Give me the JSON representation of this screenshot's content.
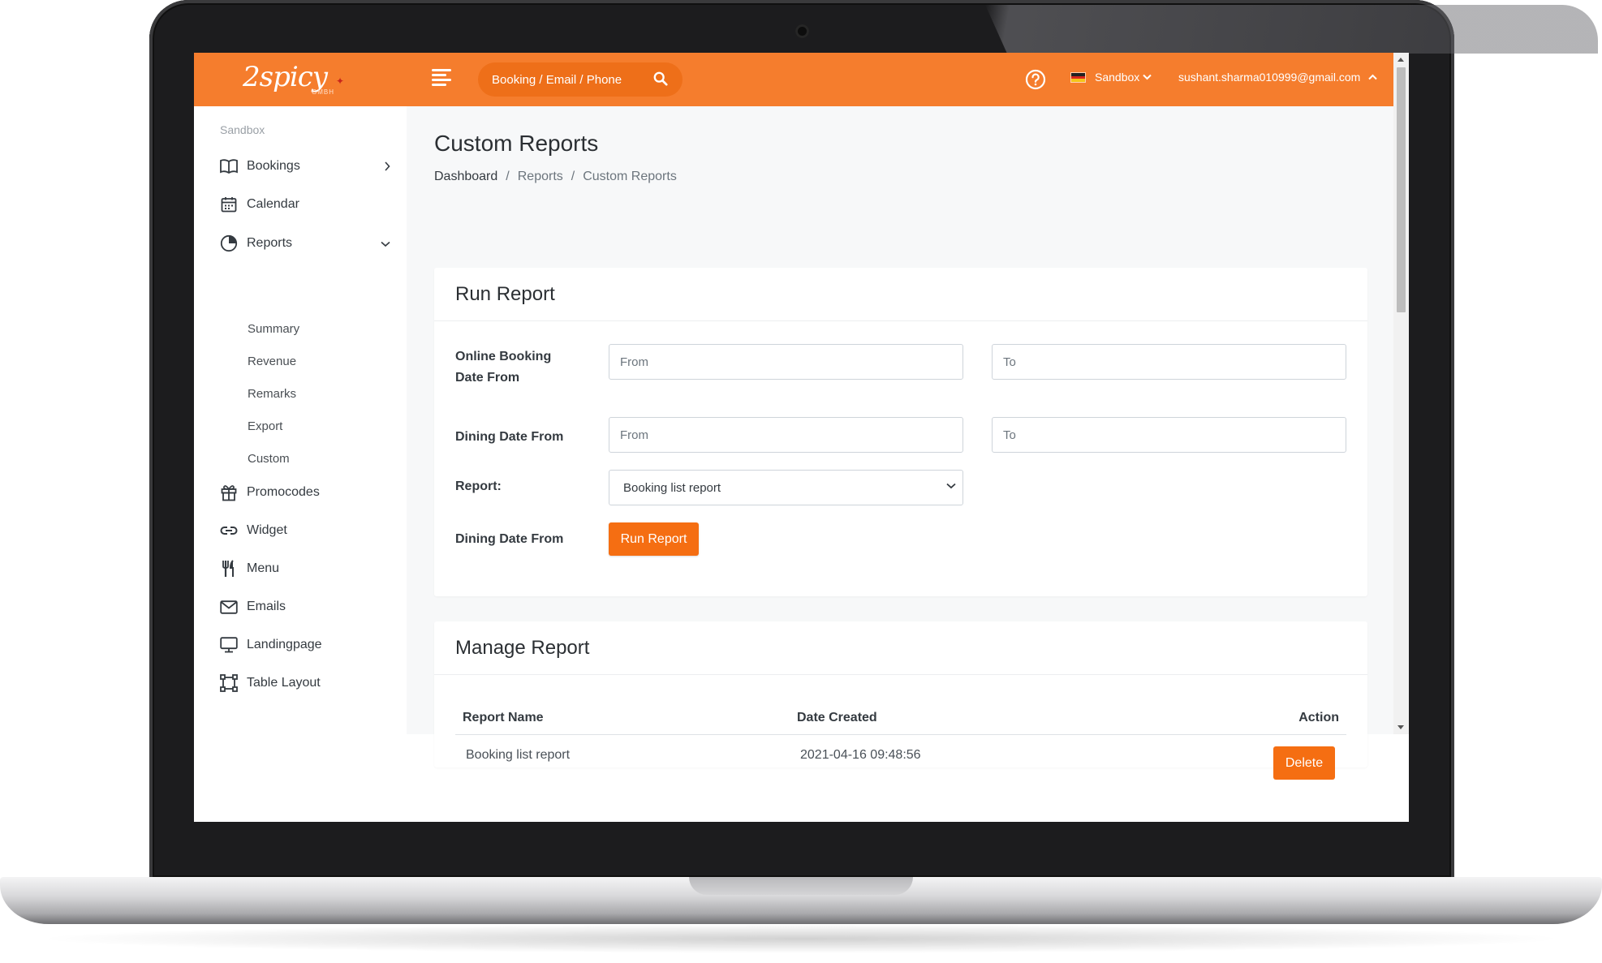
{
  "topbar": {
    "logo_text": "2spicy",
    "logo_sub": "GMBH",
    "search_placeholder": "Booking / Email / Phone",
    "environment": "Sandbox",
    "user_email": "sushant.sharma010999@gmail.com"
  },
  "sidebar": {
    "heading": "Sandbox",
    "items": [
      {
        "label": "Bookings",
        "icon": "book-icon"
      },
      {
        "label": "Calendar",
        "icon": "calendar-icon"
      },
      {
        "label": "Reports",
        "icon": "pie-chart-icon"
      },
      {
        "label": "Promocodes",
        "icon": "gift-icon"
      },
      {
        "label": "Widget",
        "icon": "link-icon"
      },
      {
        "label": "Menu",
        "icon": "utensils-icon"
      },
      {
        "label": "Emails",
        "icon": "envelope-icon"
      },
      {
        "label": "Landingpage",
        "icon": "monitor-icon"
      },
      {
        "label": "Table Layout",
        "icon": "layout-icon"
      }
    ],
    "report_subitems": [
      "Summary",
      "Revenue",
      "Remarks",
      "Export",
      "Custom"
    ]
  },
  "page": {
    "title": "Custom Reports",
    "breadcrumb": [
      "Dashboard",
      "Reports",
      "Custom Reports"
    ],
    "breadcrumb_sep": "/"
  },
  "run_report": {
    "title": "Run Report",
    "online_booking_label_line1": "Online Booking",
    "online_booking_label_line2": "Date From",
    "dining_date_label": "Dining Date From",
    "from_placeholder": "From",
    "to_placeholder": "To",
    "report_label": "Report:",
    "report_selected": "Booking list report",
    "run_row_label": "Dining Date From",
    "run_button": "Run Report"
  },
  "manage_report": {
    "title": "Manage Report",
    "columns": [
      "Report Name",
      "Date Created",
      "Action"
    ],
    "rows": [
      {
        "name": "Booking list report",
        "date": "2021-04-16 09:48:56",
        "action": "Delete"
      }
    ]
  },
  "colors": {
    "brand_orange": "#f57d2d",
    "button_orange": "#f56e12"
  }
}
